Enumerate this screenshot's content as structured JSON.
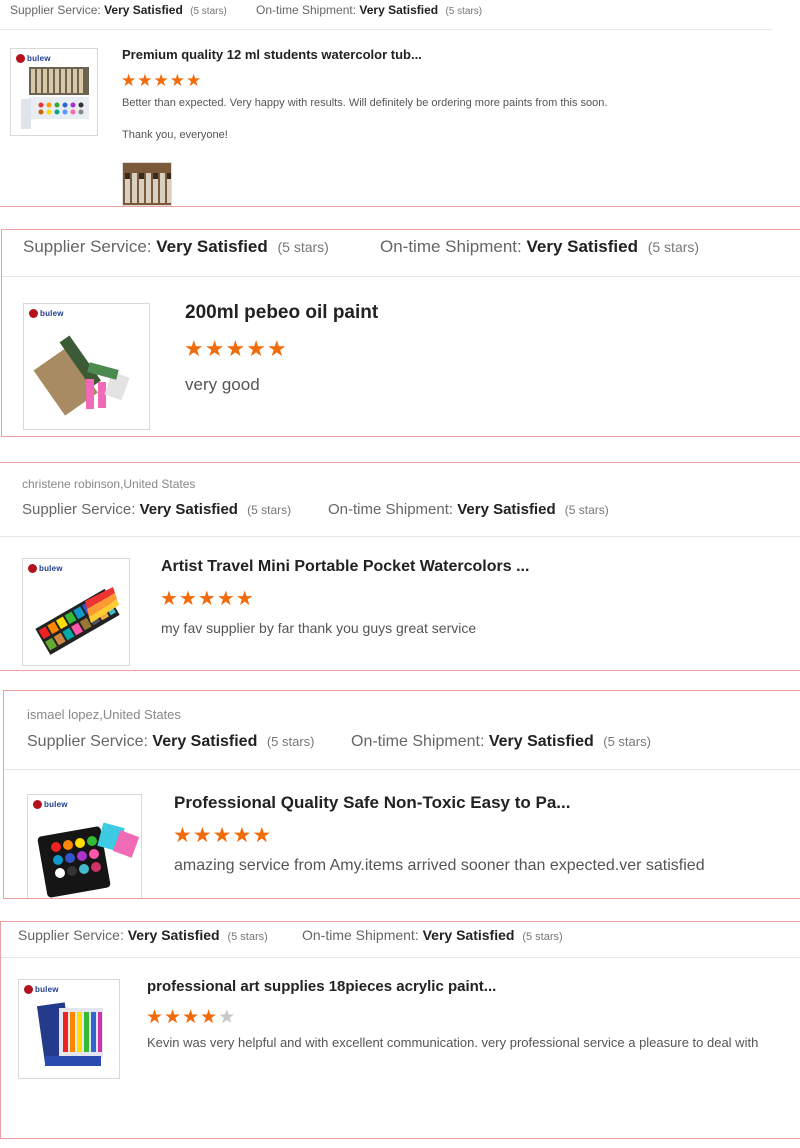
{
  "labels": {
    "supplier_service": "Supplier Service:",
    "ontime_shipment": "On-time Shipment:"
  },
  "reviews": [
    {
      "supplier_rating": "Very Satisfied",
      "supplier_stars": "(5 stars)",
      "shipment_rating": "Very Satisfied",
      "shipment_stars": "(5 stars)",
      "logo": "bulew",
      "title": "Premium quality 12 ml students watercolor tub...",
      "stars": 5,
      "comment": "Better than expected. Very happy with results. Will definitely be ordering more paints from this soon.",
      "comment2": "Thank you, everyone!"
    },
    {
      "supplier_rating": "Very Satisfied",
      "supplier_stars": "(5 stars)",
      "shipment_rating": "Very Satisfied",
      "shipment_stars": "(5 stars)",
      "logo": "bulew",
      "title": "200ml pebeo oil paint",
      "stars": 5,
      "comment": "very good"
    },
    {
      "reviewer": "christene robinson,United States",
      "supplier_rating": "Very Satisfied",
      "supplier_stars": "(5 stars)",
      "shipment_rating": "Very Satisfied",
      "shipment_stars": "(5 stars)",
      "logo": "bulew",
      "title": "Artist Travel Mini Portable Pocket Watercolors ...",
      "stars": 5,
      "comment": "my fav supplier by far thank you guys great service"
    },
    {
      "reviewer": "ismael lopez,United States",
      "supplier_rating": "Very Satisfied",
      "supplier_stars": "(5 stars)",
      "shipment_rating": "Very Satisfied",
      "shipment_stars": "(5 stars)",
      "logo": "bulew",
      "title": "Professional Quality Safe Non-Toxic Easy to Pa...",
      "stars": 5,
      "comment": "amazing service from Amy.items arrived sooner than expected.ver satisfied"
    },
    {
      "supplier_rating": "Very Satisfied",
      "supplier_stars": "(5 stars)",
      "shipment_rating": "Very Satisfied",
      "shipment_stars": "(5 stars)",
      "logo": "bulew",
      "title": "professional art supplies 18pieces acrylic paint...",
      "stars": 4,
      "max_stars": 5,
      "comment": "Kevin was very helpful and with excellent communication. very professional service a pleasure to deal with"
    }
  ],
  "colors": {
    "star": "#f26b0a",
    "star_empty": "#c8c8c8",
    "separator": "#e8a0a0",
    "logo_red": "#b3121c",
    "logo_blue": "#1e3f8f"
  },
  "icons": [
    "star-icon",
    "logo-icon"
  ]
}
